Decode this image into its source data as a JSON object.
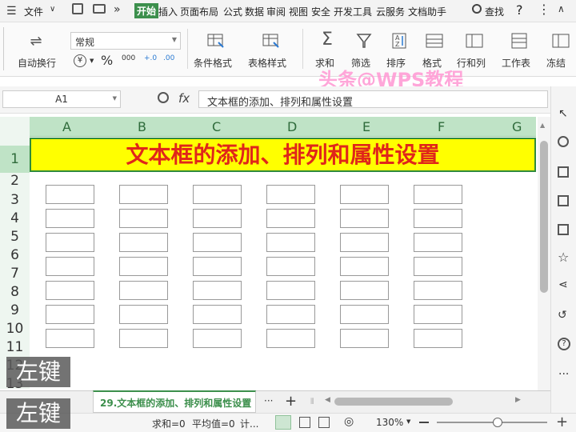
{
  "menubar": {
    "file": "文件",
    "tabs": [
      "开始",
      "插入",
      "页面布局",
      "公式",
      "数据",
      "审阅",
      "视图",
      "安全",
      "开发工具",
      "云服务",
      "文档助手"
    ],
    "search": "查找",
    "help": "?"
  },
  "ribbon": {
    "wrap": "自动换行",
    "format_select": "常规",
    "cond_format": "条件格式",
    "table_style": "表格样式",
    "sum": "求和",
    "filter": "筛选",
    "sort": "排序",
    "format": "格式",
    "rowcol": "行和列",
    "worksheet": "工作表",
    "freeze": "冻结",
    "watermark": "头条@WPS教程",
    "num_icons": [
      "%",
      "000",
      "+.0",
      ".00"
    ]
  },
  "formula_bar": {
    "cell_ref": "A1",
    "fx": "fx",
    "content": "文本框的添加、排列和属性设置"
  },
  "grid": {
    "columns": [
      "A",
      "B",
      "C",
      "D",
      "E",
      "F",
      "G"
    ],
    "rows": [
      "1",
      "2",
      "3",
      "4",
      "5",
      "6",
      "7",
      "8",
      "9",
      "10",
      "11",
      "12",
      "13"
    ],
    "title": "文本框的添加、排列和属性设置",
    "title_bg": "#ffff00",
    "title_color": "#e0261a",
    "textbox_rows": 7,
    "textbox_cols": 6
  },
  "tabbar": {
    "sheet_name": "29.文本框的添加、排列和属性设置",
    "more": "···",
    "add": "+"
  },
  "status": {
    "sum": "求和=0",
    "avg": "平均值=0",
    "count": "计...",
    "zoom": "130%"
  },
  "overlay": {
    "key1": "左键",
    "key2": "左键"
  }
}
